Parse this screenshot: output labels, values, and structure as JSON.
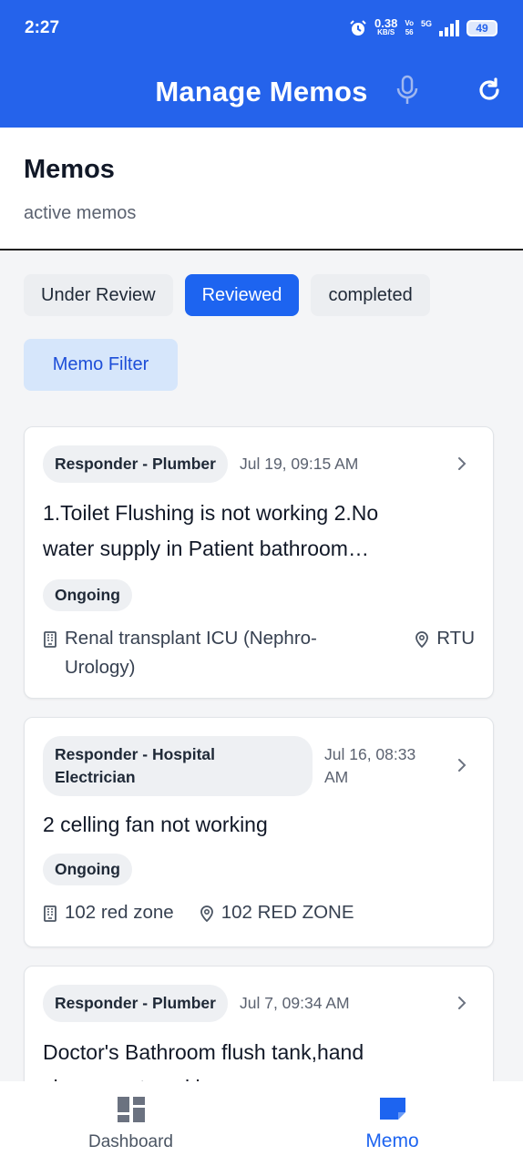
{
  "status_bar": {
    "time": "2:27",
    "net_speed": "0.38",
    "net_unit": "KB/S",
    "volte_top": "Vo",
    "volte_bottom": "56",
    "network": "5G",
    "battery": "49"
  },
  "app_bar": {
    "title": "Manage Memos",
    "icons": [
      "microphone-icon",
      "refresh-icon"
    ]
  },
  "header": {
    "title": "Memos",
    "subtitle": "active memos"
  },
  "tabs": [
    {
      "label": "Under Review",
      "active": false
    },
    {
      "label": "Reviewed",
      "active": true
    },
    {
      "label": "completed",
      "active": false
    }
  ],
  "filter_button": "Memo Filter",
  "memos": [
    {
      "responder": "Responder - Plumber",
      "date": "Jul 19, 09:15 AM",
      "title_line1": "1.Toilet Flushing is not working 2.No",
      "title_line2": "water supply in Patient bathroom…",
      "status": "Ongoing",
      "location_line1": "Renal transplant ICU (Nephro-",
      "location_line2": "Urology)",
      "area": "RTU"
    },
    {
      "responder_line1": "Responder - Hospital",
      "responder_line2": "Electrician",
      "date_line1": "Jul 16, 08:33",
      "date_line2": "AM",
      "title": "2 celling fan not working",
      "status": "Ongoing",
      "location": "102 red zone",
      "area": "102 RED ZONE"
    },
    {
      "responder": "Responder - Plumber",
      "date": "Jul 7, 09:34 AM",
      "title_line1": "Doctor's Bathroom flush tank,hand",
      "title_line2": "shower not working"
    }
  ],
  "bottom_nav": [
    {
      "label": "Dashboard",
      "icon": "dashboard-icon",
      "active": false
    },
    {
      "label": "Memo",
      "icon": "memo-icon",
      "active": true
    }
  ],
  "colors": {
    "primary": "#2563eb",
    "active_tab": "#1d64f0",
    "filter_bg": "#d6e6fb",
    "pill_bg": "#eef0f3"
  }
}
